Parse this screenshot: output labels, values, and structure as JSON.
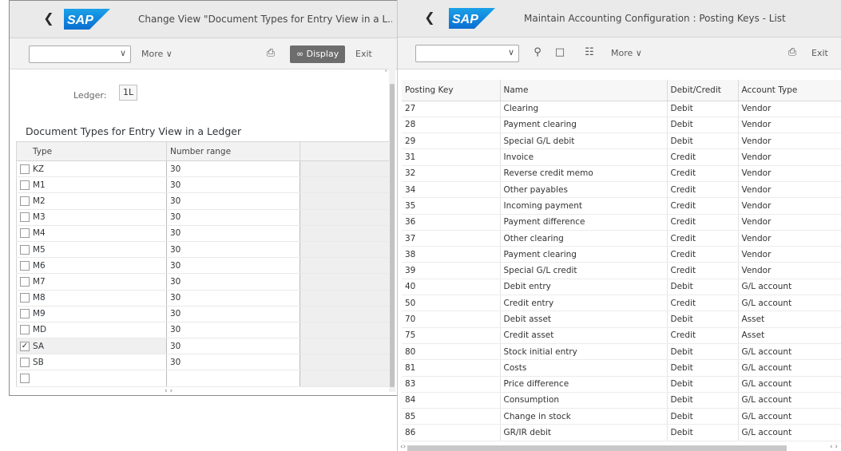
{
  "left": {
    "title": "Change View \"Document Types for Entry View in a L...",
    "toolbar": {
      "command_value": "",
      "more_label": "More",
      "display_label": "Display",
      "exit_label": "Exit"
    },
    "ledger": {
      "label": "Ledger:",
      "value": "1L"
    },
    "section_title": "Document Types for Entry View in a Ledger",
    "columns": {
      "type": "Type",
      "number_range": "Number range"
    },
    "rows": [
      {
        "type": "KZ",
        "number_range": "30",
        "checked": false
      },
      {
        "type": "M1",
        "number_range": "30",
        "checked": false
      },
      {
        "type": "M2",
        "number_range": "30",
        "checked": false
      },
      {
        "type": "M3",
        "number_range": "30",
        "checked": false
      },
      {
        "type": "M4",
        "number_range": "30",
        "checked": false
      },
      {
        "type": "M5",
        "number_range": "30",
        "checked": false
      },
      {
        "type": "M6",
        "number_range": "30",
        "checked": false
      },
      {
        "type": "M7",
        "number_range": "30",
        "checked": false
      },
      {
        "type": "M8",
        "number_range": "30",
        "checked": false
      },
      {
        "type": "M9",
        "number_range": "30",
        "checked": false
      },
      {
        "type": "MD",
        "number_range": "30",
        "checked": false
      },
      {
        "type": "SA",
        "number_range": "30",
        "checked": true
      },
      {
        "type": "SB",
        "number_range": "30",
        "checked": false
      },
      {
        "type": "",
        "number_range": "",
        "checked": false
      }
    ]
  },
  "right": {
    "title": "Maintain Accounting Configuration : Posting Keys - List",
    "toolbar": {
      "command_value": "",
      "more_label": "More",
      "exit_label": "Exit"
    },
    "columns": {
      "posting_key": "Posting Key",
      "name": "Name",
      "debit_credit": "Debit/Credit",
      "account_type": "Account Type"
    },
    "rows": [
      {
        "key": "27",
        "name": "Clearing",
        "dc": "Debit",
        "acct": "Vendor"
      },
      {
        "key": "28",
        "name": "Payment clearing",
        "dc": "Debit",
        "acct": "Vendor"
      },
      {
        "key": "29",
        "name": "Special G/L debit",
        "dc": "Debit",
        "acct": "Vendor"
      },
      {
        "key": "31",
        "name": "Invoice",
        "dc": "Credit",
        "acct": "Vendor"
      },
      {
        "key": "32",
        "name": "Reverse credit memo",
        "dc": "Credit",
        "acct": "Vendor"
      },
      {
        "key": "34",
        "name": "Other payables",
        "dc": "Credit",
        "acct": "Vendor"
      },
      {
        "key": "35",
        "name": "Incoming payment",
        "dc": "Credit",
        "acct": "Vendor"
      },
      {
        "key": "36",
        "name": "Payment difference",
        "dc": "Credit",
        "acct": "Vendor"
      },
      {
        "key": "37",
        "name": "Other clearing",
        "dc": "Credit",
        "acct": "Vendor"
      },
      {
        "key": "38",
        "name": "Payment clearing",
        "dc": "Credit",
        "acct": "Vendor"
      },
      {
        "key": "39",
        "name": "Special G/L credit",
        "dc": "Credit",
        "acct": "Vendor"
      },
      {
        "key": "40",
        "name": "Debit entry",
        "dc": "Debit",
        "acct": "G/L account"
      },
      {
        "key": "50",
        "name": "Credit entry",
        "dc": "Credit",
        "acct": "G/L account"
      },
      {
        "key": "70",
        "name": "Debit asset",
        "dc": "Debit",
        "acct": "Asset"
      },
      {
        "key": "75",
        "name": "Credit asset",
        "dc": "Credit",
        "acct": "Asset"
      },
      {
        "key": "80",
        "name": "Stock initial entry",
        "dc": "Debit",
        "acct": "G/L account"
      },
      {
        "key": "81",
        "name": "Costs",
        "dc": "Debit",
        "acct": "G/L account"
      },
      {
        "key": "83",
        "name": "Price difference",
        "dc": "Debit",
        "acct": "G/L account"
      },
      {
        "key": "84",
        "name": "Consumption",
        "dc": "Debit",
        "acct": "G/L account"
      },
      {
        "key": "85",
        "name": "Change in stock",
        "dc": "Debit",
        "acct": "G/L account"
      },
      {
        "key": "86",
        "name": "GR/IR debit",
        "dc": "Debit",
        "acct": "G/L account"
      }
    ]
  },
  "brand": {
    "logo_text": "SAP",
    "logo_color": "#0a6ed1"
  },
  "icons": [
    "back-arrow-icon",
    "chevron-down-icon",
    "print-icon",
    "display-glasses-icon",
    "search-icon",
    "new-document-icon",
    "delete-icon"
  ]
}
